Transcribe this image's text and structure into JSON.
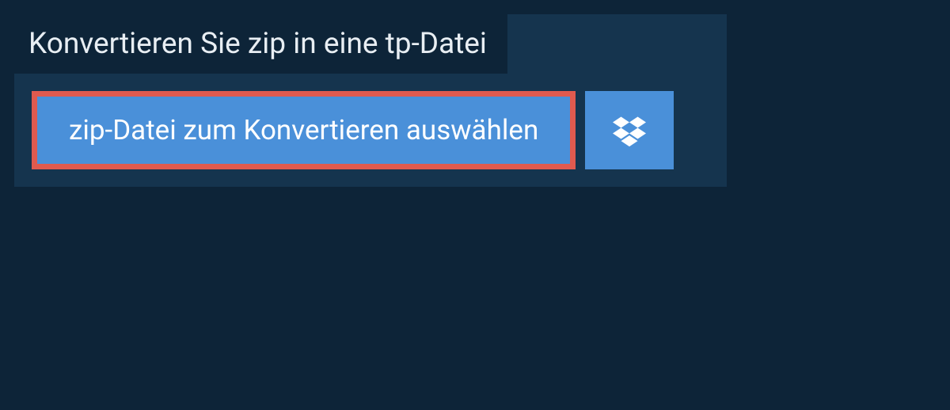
{
  "header": {
    "title": "Konvertieren Sie zip in eine tp-Datei"
  },
  "actions": {
    "select_file_label": "zip-Datei zum Konvertieren auswählen"
  },
  "colors": {
    "page_bg": "#0d2438",
    "panel_bg": "#15344e",
    "button_bg": "#4a90d9",
    "highlight_border": "#e05a4f"
  }
}
